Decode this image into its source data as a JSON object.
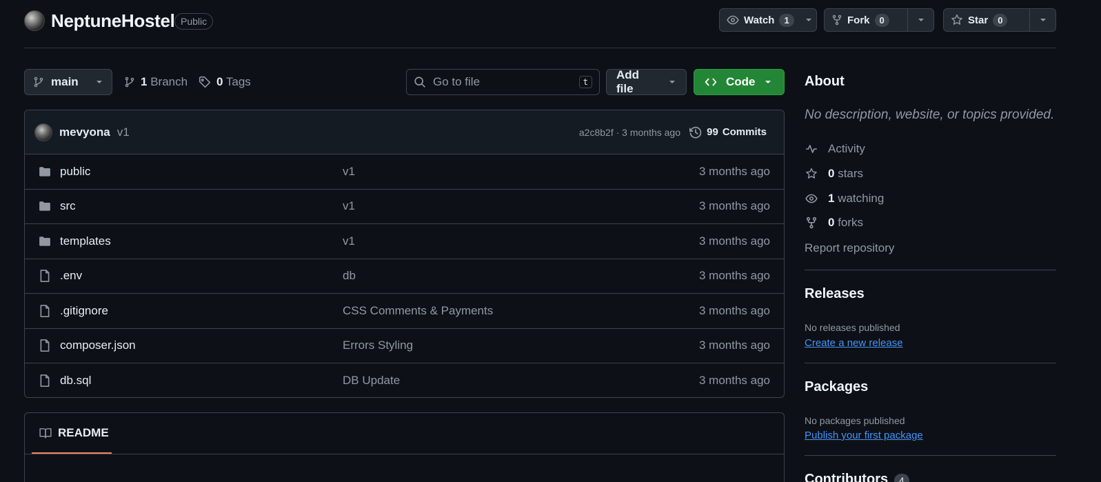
{
  "repo": {
    "name": "NeptuneHostel",
    "visibility": "Public",
    "watch_label": "Watch",
    "watch_count": "1",
    "fork_label": "Fork",
    "fork_count": "0",
    "star_label": "Star",
    "star_count": "0"
  },
  "toolbar": {
    "branch": "main",
    "branch_count": "1",
    "branch_label": "Branch",
    "tag_count": "0",
    "tag_label": "Tags",
    "goto_placeholder": "Go to file",
    "goto_shortcut": "t",
    "add_file_label": "Add file",
    "code_label": "Code"
  },
  "commit": {
    "author": "mevyona",
    "message": "v1",
    "meta": "a2c8b2f · 3 months ago",
    "commits_count": "99",
    "commits_label": "Commits"
  },
  "files": [
    {
      "name": "public",
      "type": "folder",
      "message": "v1",
      "date": "3 months ago"
    },
    {
      "name": "src",
      "type": "folder",
      "message": "v1",
      "date": "3 months ago"
    },
    {
      "name": "templates",
      "type": "folder",
      "message": "v1",
      "date": "3 months ago"
    },
    {
      "name": ".env",
      "type": "file",
      "message": "db",
      "date": "3 months ago"
    },
    {
      "name": ".gitignore",
      "type": "file",
      "message": "CSS Comments & Payments",
      "date": "3 months ago"
    },
    {
      "name": "composer.json",
      "type": "file",
      "message": "Errors Styling",
      "date": "3 months ago"
    },
    {
      "name": "db.sql",
      "type": "file",
      "message": "DB Update",
      "date": "3 months ago"
    }
  ],
  "readme": {
    "tab_label": "README"
  },
  "sidebar": {
    "about_title": "About",
    "about_desc": "No description, website, or topics provided.",
    "activity_label": "Activity",
    "stars_count": "0",
    "stars_label": "stars",
    "watching_count": "1",
    "watching_label": "watching",
    "forks_count": "0",
    "forks_label": "forks",
    "report_label": "Report repository",
    "releases_title": "Releases",
    "releases_empty": "No releases published",
    "releases_link": "Create a new release",
    "packages_title": "Packages",
    "packages_empty": "No packages published",
    "packages_link": "Publish your first package",
    "contributors_title": "Contributors",
    "contributors_count": "4"
  },
  "colors": {
    "background": "#0d1117",
    "border": "#3d444d",
    "accent_green": "#238636",
    "link_blue": "#4493f8",
    "readme_underline": "#f78166"
  }
}
